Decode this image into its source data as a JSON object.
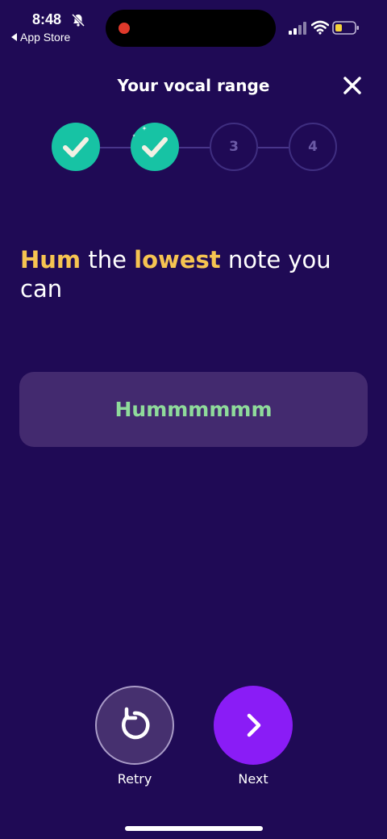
{
  "status_bar": {
    "time": "8:48",
    "back_label": "App Store"
  },
  "header": {
    "title": "Your vocal range"
  },
  "stepper": {
    "steps": [
      {
        "label": "",
        "state": "done"
      },
      {
        "label": "",
        "state": "done"
      },
      {
        "label": "3",
        "state": "todo"
      },
      {
        "label": "4",
        "state": "todo"
      }
    ]
  },
  "prompt": {
    "part1": "Hum",
    "part2": " the ",
    "part3": "lowest",
    "part4": " note you can"
  },
  "hum_card": {
    "text": "Hummmmmm"
  },
  "controls": {
    "retry_label": "Retry",
    "next_label": "Next"
  },
  "colors": {
    "background": "#1f0a55",
    "step_done": "#17c3a4",
    "highlight": "#f6c451",
    "hum_text": "#8fdb9b",
    "next_button": "#8a1cf6"
  }
}
